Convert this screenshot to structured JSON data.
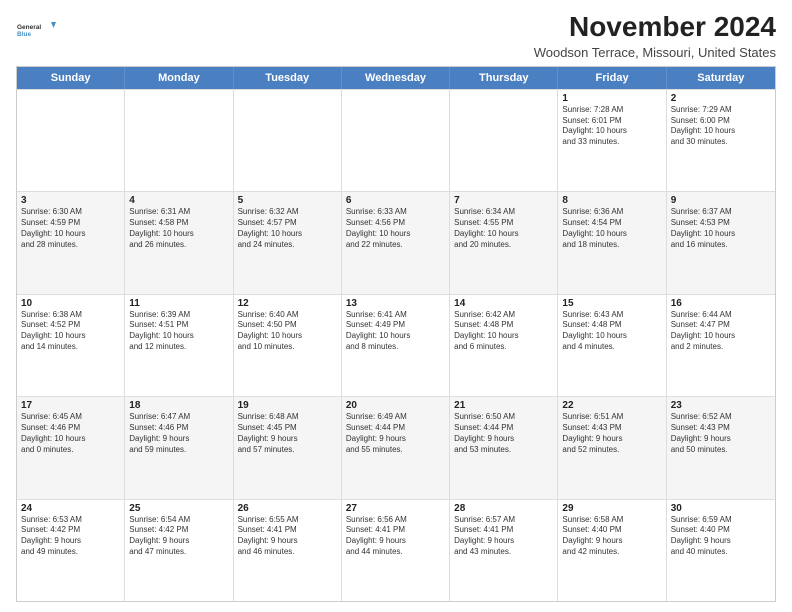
{
  "logo": {
    "line1": "General",
    "line2": "Blue"
  },
  "title": "November 2024",
  "subtitle": "Woodson Terrace, Missouri, United States",
  "days_of_week": [
    "Sunday",
    "Monday",
    "Tuesday",
    "Wednesday",
    "Thursday",
    "Friday",
    "Saturday"
  ],
  "weeks": [
    [
      {
        "day": "",
        "info": ""
      },
      {
        "day": "",
        "info": ""
      },
      {
        "day": "",
        "info": ""
      },
      {
        "day": "",
        "info": ""
      },
      {
        "day": "",
        "info": ""
      },
      {
        "day": "1",
        "info": "Sunrise: 7:28 AM\nSunset: 6:01 PM\nDaylight: 10 hours\nand 33 minutes."
      },
      {
        "day": "2",
        "info": "Sunrise: 7:29 AM\nSunset: 6:00 PM\nDaylight: 10 hours\nand 30 minutes."
      }
    ],
    [
      {
        "day": "3",
        "info": "Sunrise: 6:30 AM\nSunset: 4:59 PM\nDaylight: 10 hours\nand 28 minutes."
      },
      {
        "day": "4",
        "info": "Sunrise: 6:31 AM\nSunset: 4:58 PM\nDaylight: 10 hours\nand 26 minutes."
      },
      {
        "day": "5",
        "info": "Sunrise: 6:32 AM\nSunset: 4:57 PM\nDaylight: 10 hours\nand 24 minutes."
      },
      {
        "day": "6",
        "info": "Sunrise: 6:33 AM\nSunset: 4:56 PM\nDaylight: 10 hours\nand 22 minutes."
      },
      {
        "day": "7",
        "info": "Sunrise: 6:34 AM\nSunset: 4:55 PM\nDaylight: 10 hours\nand 20 minutes."
      },
      {
        "day": "8",
        "info": "Sunrise: 6:36 AM\nSunset: 4:54 PM\nDaylight: 10 hours\nand 18 minutes."
      },
      {
        "day": "9",
        "info": "Sunrise: 6:37 AM\nSunset: 4:53 PM\nDaylight: 10 hours\nand 16 minutes."
      }
    ],
    [
      {
        "day": "10",
        "info": "Sunrise: 6:38 AM\nSunset: 4:52 PM\nDaylight: 10 hours\nand 14 minutes."
      },
      {
        "day": "11",
        "info": "Sunrise: 6:39 AM\nSunset: 4:51 PM\nDaylight: 10 hours\nand 12 minutes."
      },
      {
        "day": "12",
        "info": "Sunrise: 6:40 AM\nSunset: 4:50 PM\nDaylight: 10 hours\nand 10 minutes."
      },
      {
        "day": "13",
        "info": "Sunrise: 6:41 AM\nSunset: 4:49 PM\nDaylight: 10 hours\nand 8 minutes."
      },
      {
        "day": "14",
        "info": "Sunrise: 6:42 AM\nSunset: 4:48 PM\nDaylight: 10 hours\nand 6 minutes."
      },
      {
        "day": "15",
        "info": "Sunrise: 6:43 AM\nSunset: 4:48 PM\nDaylight: 10 hours\nand 4 minutes."
      },
      {
        "day": "16",
        "info": "Sunrise: 6:44 AM\nSunset: 4:47 PM\nDaylight: 10 hours\nand 2 minutes."
      }
    ],
    [
      {
        "day": "17",
        "info": "Sunrise: 6:45 AM\nSunset: 4:46 PM\nDaylight: 10 hours\nand 0 minutes."
      },
      {
        "day": "18",
        "info": "Sunrise: 6:47 AM\nSunset: 4:46 PM\nDaylight: 9 hours\nand 59 minutes."
      },
      {
        "day": "19",
        "info": "Sunrise: 6:48 AM\nSunset: 4:45 PM\nDaylight: 9 hours\nand 57 minutes."
      },
      {
        "day": "20",
        "info": "Sunrise: 6:49 AM\nSunset: 4:44 PM\nDaylight: 9 hours\nand 55 minutes."
      },
      {
        "day": "21",
        "info": "Sunrise: 6:50 AM\nSunset: 4:44 PM\nDaylight: 9 hours\nand 53 minutes."
      },
      {
        "day": "22",
        "info": "Sunrise: 6:51 AM\nSunset: 4:43 PM\nDaylight: 9 hours\nand 52 minutes."
      },
      {
        "day": "23",
        "info": "Sunrise: 6:52 AM\nSunset: 4:43 PM\nDaylight: 9 hours\nand 50 minutes."
      }
    ],
    [
      {
        "day": "24",
        "info": "Sunrise: 6:53 AM\nSunset: 4:42 PM\nDaylight: 9 hours\nand 49 minutes."
      },
      {
        "day": "25",
        "info": "Sunrise: 6:54 AM\nSunset: 4:42 PM\nDaylight: 9 hours\nand 47 minutes."
      },
      {
        "day": "26",
        "info": "Sunrise: 6:55 AM\nSunset: 4:41 PM\nDaylight: 9 hours\nand 46 minutes."
      },
      {
        "day": "27",
        "info": "Sunrise: 6:56 AM\nSunset: 4:41 PM\nDaylight: 9 hours\nand 44 minutes."
      },
      {
        "day": "28",
        "info": "Sunrise: 6:57 AM\nSunset: 4:41 PM\nDaylight: 9 hours\nand 43 minutes."
      },
      {
        "day": "29",
        "info": "Sunrise: 6:58 AM\nSunset: 4:40 PM\nDaylight: 9 hours\nand 42 minutes."
      },
      {
        "day": "30",
        "info": "Sunrise: 6:59 AM\nSunset: 4:40 PM\nDaylight: 9 hours\nand 40 minutes."
      }
    ]
  ]
}
